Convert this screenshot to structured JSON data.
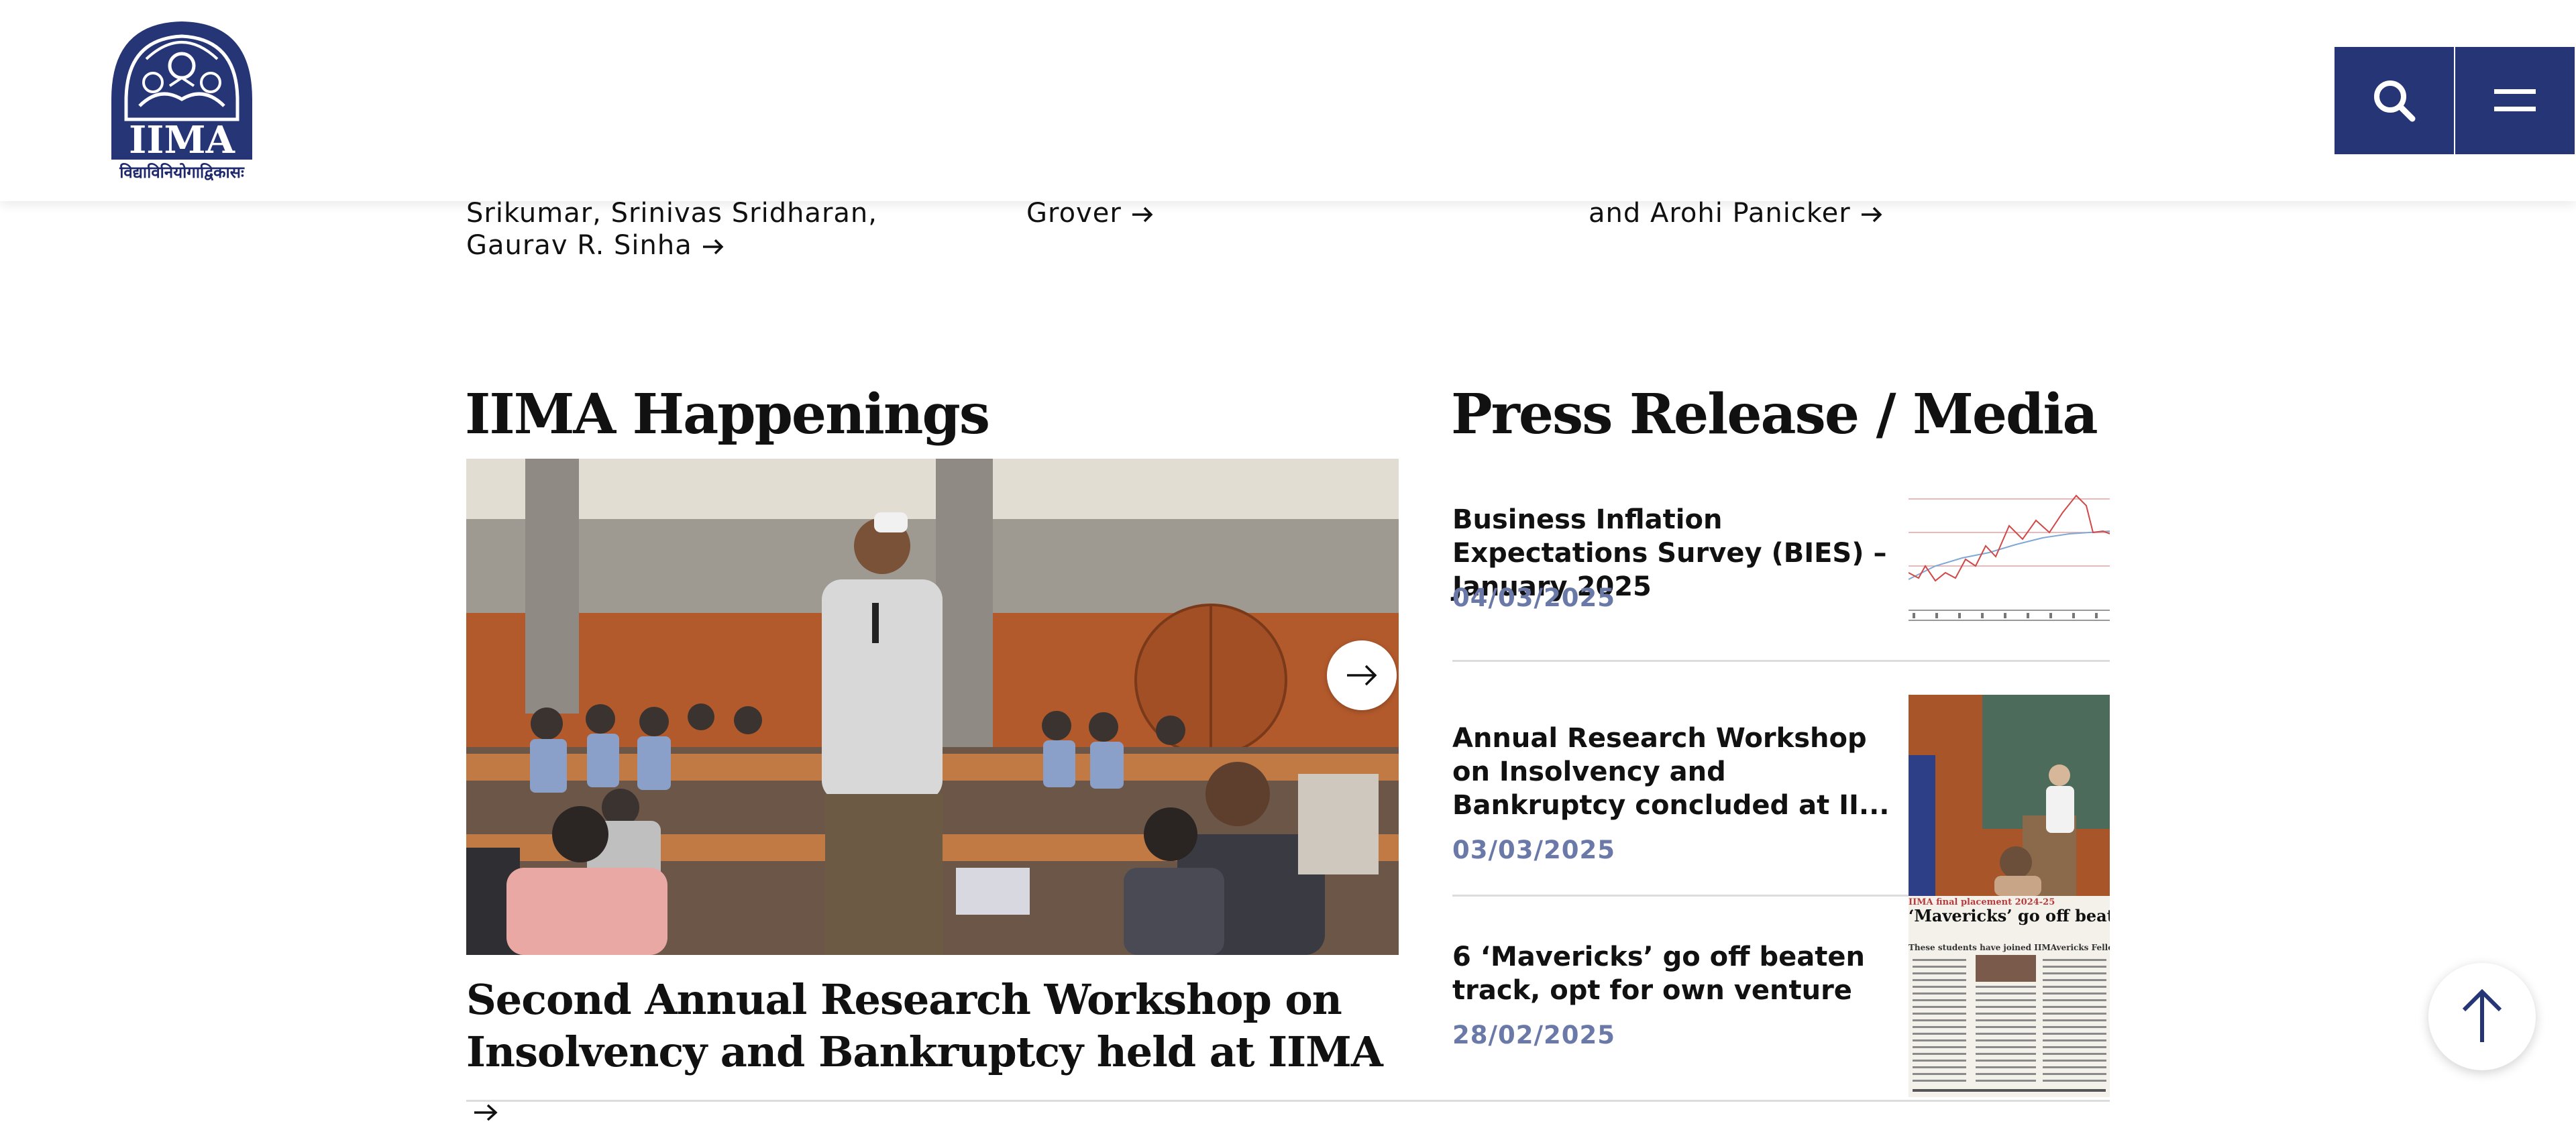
{
  "header": {
    "logo_text": "IIMA",
    "logo_tagline": "विद्याविनियोगाद्विकासः",
    "search_icon": "search-icon",
    "menu_icon": "hamburger-menu-icon",
    "brand_color": "#263576"
  },
  "authors_row": [
    {
      "text": "Srikumar, Srinivas Sridharan, Gaurav R. Sinha"
    },
    {
      "text": "Grover"
    },
    {
      "text": "and Arohi Panicker"
    }
  ],
  "happenings": {
    "heading": "IIMA Happenings",
    "slide_title": "Second Annual Research Workshop on Insolvency and Bankruptcy held at IIMA",
    "next_icon": "arrow-right-icon"
  },
  "press": {
    "heading": "Press Release / Media",
    "items": [
      {
        "title": "Business Inflation Expectations Survey (BIES) – January 2025",
        "date": "04/03/2025",
        "thumb": "line-chart-thumbnail"
      },
      {
        "title": "Annual Research Workshop on Insolvency and Bankruptcy concluded at II...",
        "date": "03/03/2025",
        "thumb": "speaker-photo-thumbnail"
      },
      {
        "title": "6 ‘Mavericks’ go off beaten track, opt for own venture",
        "date": "28/02/2025",
        "thumb": "newspaper-clipping-thumbnail"
      }
    ],
    "clipping": {
      "kicker": "IIMA final placement 2024-25",
      "headline": "‘Mavericks’ go off beaten track, opt for own venture",
      "dek": "These students have joined IIMAvericks Fellowship this year"
    },
    "date_color": "#6a79a8"
  },
  "scroll_top_icon": "arrow-up-icon"
}
